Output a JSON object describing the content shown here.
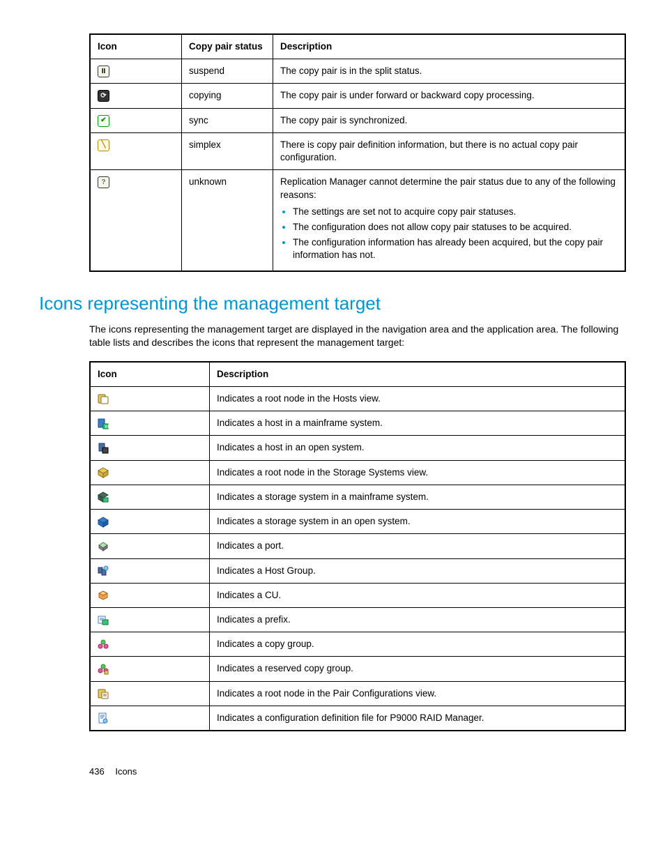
{
  "table1": {
    "headers": {
      "icon": "Icon",
      "status": "Copy pair status",
      "desc": "Description"
    },
    "rows": [
      {
        "iconName": "pause-icon",
        "status": "suspend",
        "desc": "The copy pair is in the split status."
      },
      {
        "iconName": "cycle-icon",
        "status": "copying",
        "desc": "The copy pair is under forward or backward copy processing."
      },
      {
        "iconName": "check-icon",
        "status": "sync",
        "desc": "The copy pair is synchronized."
      },
      {
        "iconName": "slash-icon",
        "status": "simplex",
        "desc": "There is copy pair definition information, but there is no actual copy pair configuration."
      },
      {
        "iconName": "question-icon",
        "status": "unknown",
        "desc_intro": "Replication Manager cannot determine the pair status due to any of the following reasons:",
        "bullets": [
          "The settings are set not to acquire copy pair statuses.",
          "The configuration does not allow copy pair statuses to be acquired.",
          "The configuration information has already been acquired, but the copy pair information has not."
        ]
      }
    ]
  },
  "section_heading": "Icons representing the management target",
  "section_intro": "The icons representing the management target are displayed in the navigation area and the application area. The following table lists and describes the icons that represent the management target:",
  "table2": {
    "headers": {
      "icon": "Icon",
      "desc": "Description"
    },
    "rows": [
      {
        "iconName": "hosts-root-icon",
        "desc": "Indicates a root node in the Hosts view."
      },
      {
        "iconName": "host-mainframe-icon",
        "desc": "Indicates a host in a mainframe system."
      },
      {
        "iconName": "host-open-icon",
        "desc": "Indicates a host in an open system."
      },
      {
        "iconName": "storage-root-icon",
        "desc": "Indicates a root node in the Storage Systems view."
      },
      {
        "iconName": "storage-mainframe-icon",
        "desc": "Indicates a storage system in a mainframe system."
      },
      {
        "iconName": "storage-open-icon",
        "desc": "Indicates a storage system in an open system."
      },
      {
        "iconName": "port-icon",
        "desc": "Indicates a port."
      },
      {
        "iconName": "host-group-icon",
        "desc": "Indicates a Host Group."
      },
      {
        "iconName": "cu-icon",
        "desc": "Indicates a CU."
      },
      {
        "iconName": "prefix-icon",
        "desc": "Indicates a prefix."
      },
      {
        "iconName": "copy-group-icon",
        "desc": "Indicates a copy group."
      },
      {
        "iconName": "reserved-copy-group-icon",
        "desc": "Indicates a reserved copy group."
      },
      {
        "iconName": "pair-config-root-icon",
        "desc": "Indicates a root node in the Pair Configurations view."
      },
      {
        "iconName": "config-def-file-icon",
        "desc": "Indicates a configuration definition file for P9000 RAID Manager."
      }
    ]
  },
  "footer": {
    "page": "436",
    "chapter": "Icons"
  }
}
